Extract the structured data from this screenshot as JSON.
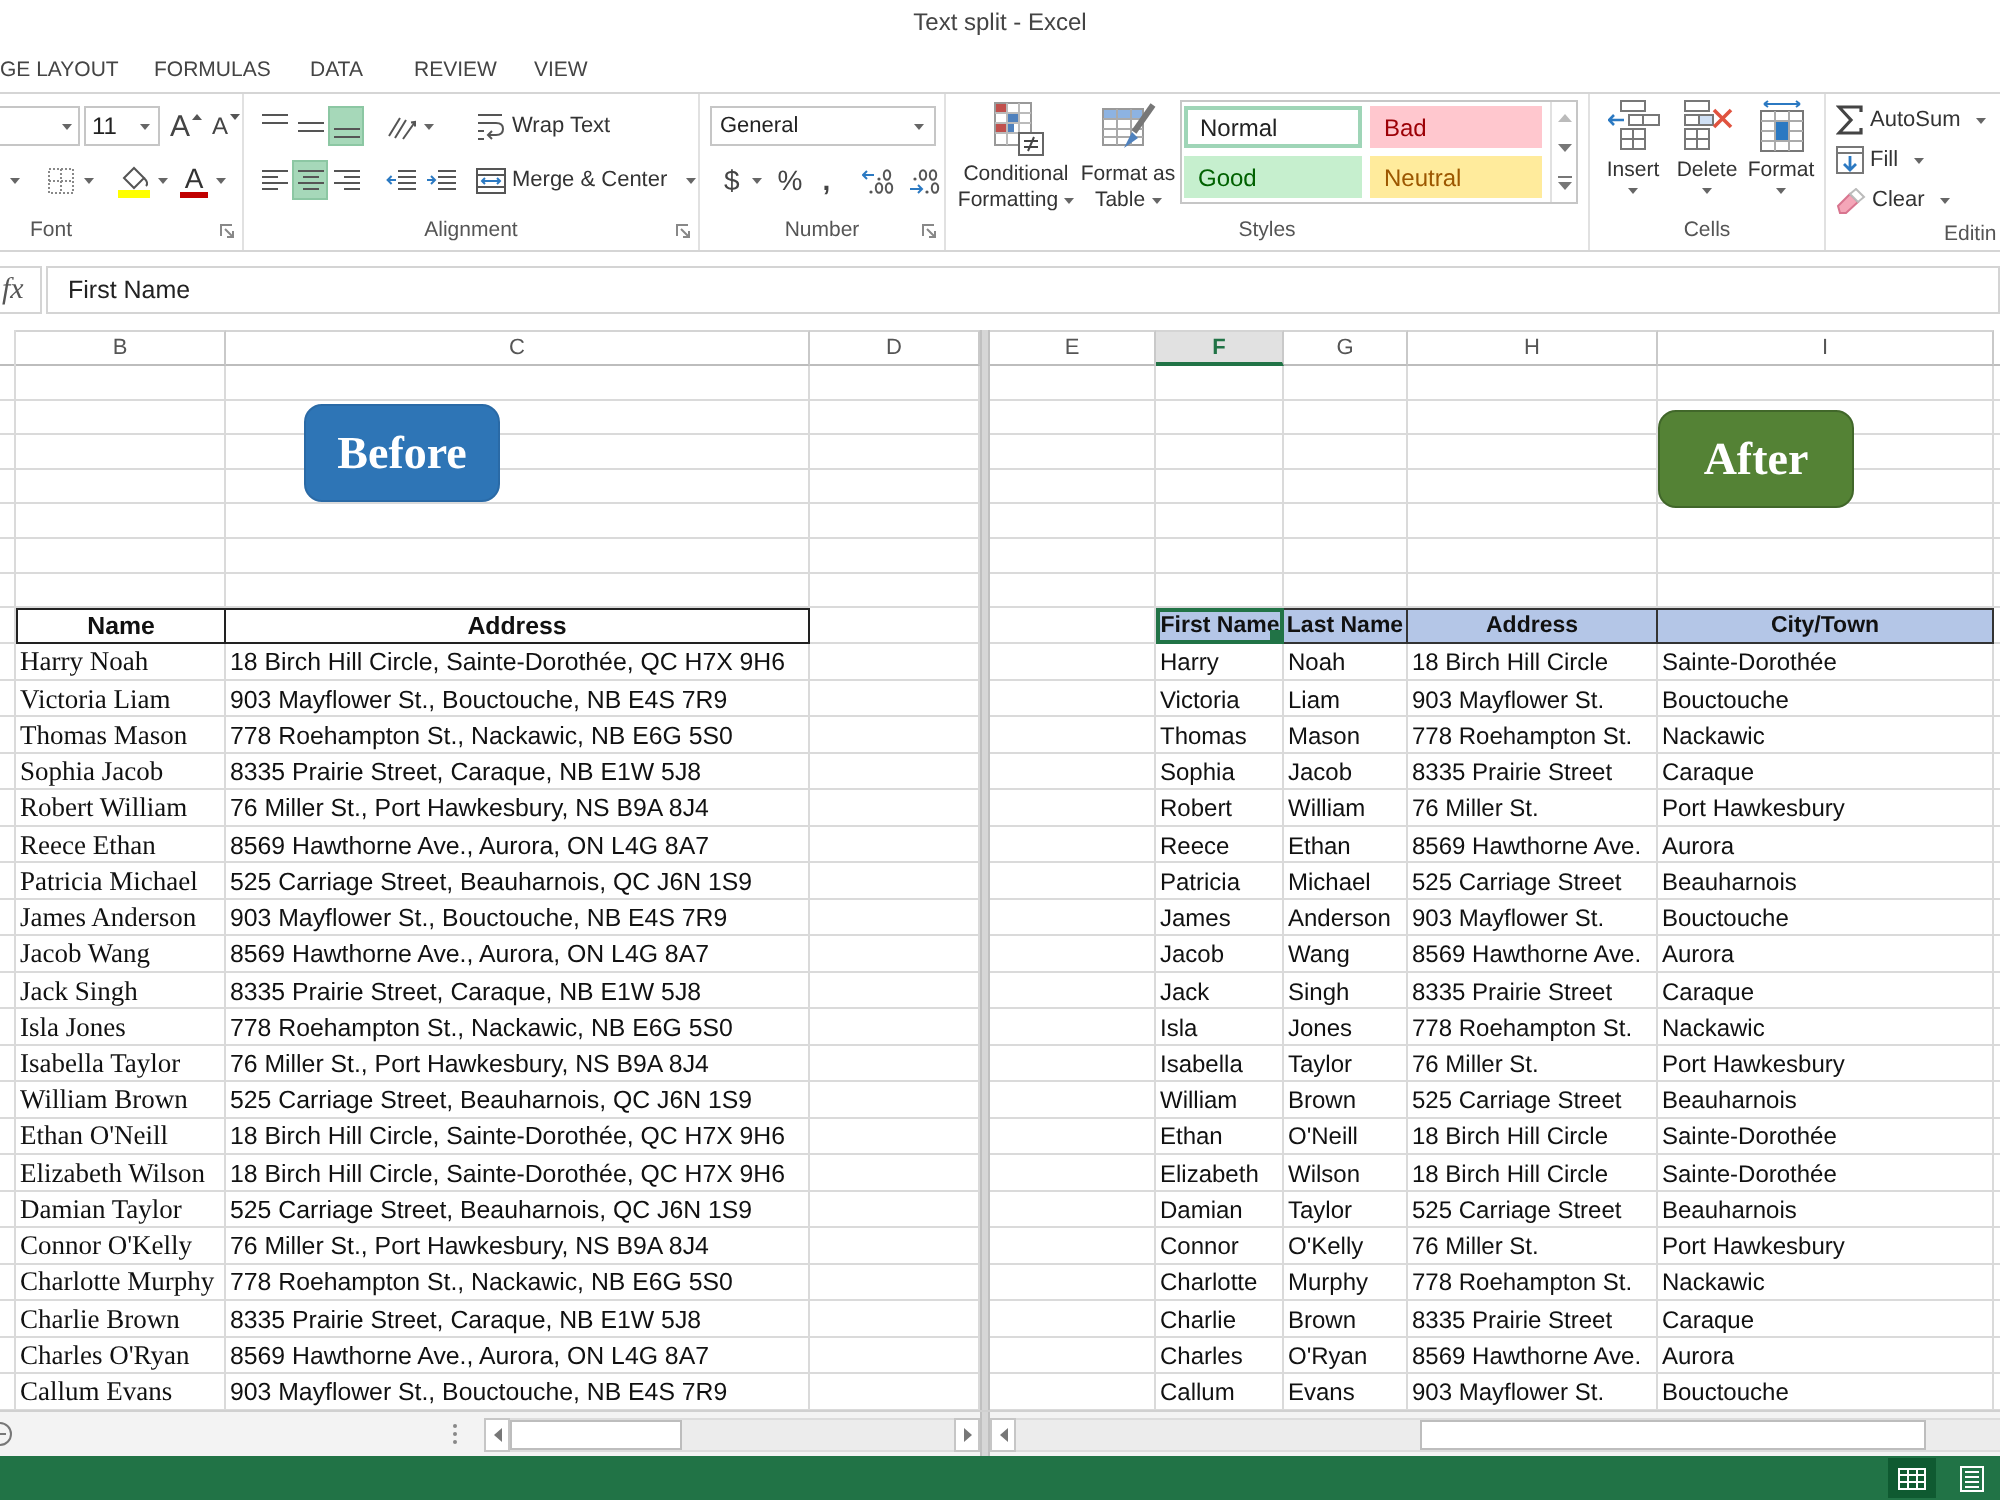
{
  "window": {
    "title": "Text split - Excel"
  },
  "ribbon_tabs": [
    "GE LAYOUT",
    "FORMULAS",
    "DATA",
    "REVIEW",
    "VIEW"
  ],
  "font_group": {
    "label": "Font",
    "font_size": "11",
    "grow_font": "A",
    "shrink_font": "A",
    "font_color": "A"
  },
  "alignment_group": {
    "label": "Alignment",
    "align_buttons": [
      {
        "kind": "top",
        "selected": false
      },
      {
        "kind": "middle",
        "selected": false
      },
      {
        "kind": "bottom",
        "selected": true
      },
      {
        "kind": "left",
        "selected": false
      },
      {
        "kind": "center",
        "selected": true
      },
      {
        "kind": "right",
        "selected": false
      }
    ],
    "wrap_text": "Wrap Text",
    "merge_center": "Merge & Center"
  },
  "number_group": {
    "label": "Number",
    "format": "General",
    "symbols": [
      {
        "text": "$",
        "dropdown": true
      },
      {
        "text": "%",
        "dropdown": false
      },
      {
        "text": ",",
        "dropdown": false
      }
    ],
    "decimal_buttons": [
      {
        "kind": "increase"
      },
      {
        "kind": "decrease"
      }
    ]
  },
  "styles_group": {
    "label": "Styles",
    "conditional_formatting": "Conditional Formatting",
    "format_as_table": "Format as Table",
    "cell_styles": [
      {
        "label": "Normal",
        "kind": "normal",
        "selected": true
      },
      {
        "label": "Bad",
        "kind": "bad",
        "selected": false
      },
      {
        "label": "Good",
        "kind": "good",
        "selected": false
      },
      {
        "label": "Neutral",
        "kind": "neutral",
        "selected": false
      }
    ]
  },
  "cells_group": {
    "label": "Cells",
    "buttons": [
      {
        "kind": "insert",
        "label": "Insert"
      },
      {
        "kind": "delete",
        "label": "Delete"
      },
      {
        "kind": "format",
        "label": "Format"
      }
    ]
  },
  "editing_group": {
    "label": "Editin",
    "buttons": [
      {
        "kind": "autosum",
        "label": "AutoSum"
      },
      {
        "kind": "fill",
        "label": "Fill"
      },
      {
        "kind": "clear",
        "label": "Clear"
      }
    ]
  },
  "formula_bar": {
    "function_label": "fx",
    "value": "First Name"
  },
  "left_pane": {
    "columns": [
      {
        "label": "B",
        "selected": false
      },
      {
        "label": "C",
        "selected": false
      },
      {
        "label": "D",
        "selected": false
      }
    ],
    "banner": "Before",
    "table": {
      "columns": [
        "Name",
        "Address"
      ],
      "rows": [
        [
          "Harry Noah",
          "18 Birch Hill Circle, Sainte-Dorothée, QC H7X 9H6"
        ],
        [
          "Victoria Liam",
          "903 Mayflower St., Bouctouche, NB E4S 7R9"
        ],
        [
          "Thomas Mason",
          "778 Roehampton St., Nackawic, NB E6G 5S0"
        ],
        [
          "Sophia Jacob",
          "8335 Prairie Street, Caraque, NB E1W 5J8"
        ],
        [
          "Robert William",
          "76 Miller St., Port Hawkesbury, NS B9A 8J4"
        ],
        [
          "Reece Ethan",
          "8569 Hawthorne Ave., Aurora, ON L4G 8A7"
        ],
        [
          "Patricia Michael",
          "525 Carriage Street, Beauharnois, QC J6N 1S9"
        ],
        [
          "James Anderson",
          "903 Mayflower St., Bouctouche, NB E4S 7R9"
        ],
        [
          "Jacob Wang",
          "8569 Hawthorne Ave., Aurora, ON L4G 8A7"
        ],
        [
          "Jack Singh",
          "8335 Prairie Street, Caraque, NB E1W 5J8"
        ],
        [
          "Isla Jones",
          "778 Roehampton St., Nackawic, NB E6G 5S0"
        ],
        [
          "Isabella Taylor",
          "76 Miller St., Port Hawkesbury, NS B9A 8J4"
        ],
        [
          "William Brown",
          "525 Carriage Street, Beauharnois, QC J6N 1S9"
        ],
        [
          "Ethan O'Neill",
          "18 Birch Hill Circle, Sainte-Dorothée, QC H7X 9H6"
        ],
        [
          "Elizabeth Wilson",
          "18 Birch Hill Circle, Sainte-Dorothée, QC H7X 9H6"
        ],
        [
          "Damian Taylor",
          "525 Carriage Street, Beauharnois, QC J6N 1S9"
        ],
        [
          "Connor O'Kelly",
          "76 Miller St., Port Hawkesbury, NS B9A 8J4"
        ],
        [
          "Charlotte Murphy",
          "778 Roehampton St., Nackawic, NB E6G 5S0"
        ],
        [
          "Charlie Brown",
          "8335 Prairie Street, Caraque, NB E1W 5J8"
        ],
        [
          "Charles O'Ryan",
          "8569 Hawthorne Ave., Aurora, ON L4G 8A7"
        ],
        [
          "Callum Evans",
          "903 Mayflower St., Bouctouche, NB E4S 7R9"
        ]
      ]
    }
  },
  "right_pane": {
    "columns": [
      {
        "label": "E",
        "selected": false
      },
      {
        "label": "F",
        "selected": true
      },
      {
        "label": "G",
        "selected": false
      },
      {
        "label": "H",
        "selected": false
      },
      {
        "label": "I",
        "selected": false
      }
    ],
    "banner": "After",
    "table": {
      "columns": [
        {
          "label": "First Name",
          "selected": true
        },
        {
          "label": "Last Name",
          "selected": false
        },
        {
          "label": "Address",
          "selected": false
        },
        {
          "label": "City/Town",
          "selected": false
        }
      ],
      "rows": [
        [
          "Harry",
          "Noah",
          "18 Birch Hill Circle",
          "Sainte-Dorothée"
        ],
        [
          "Victoria",
          "Liam",
          "903 Mayflower St.",
          "Bouctouche"
        ],
        [
          "Thomas",
          "Mason",
          "778 Roehampton St.",
          "Nackawic"
        ],
        [
          "Sophia",
          "Jacob",
          "8335 Prairie Street",
          "Caraque"
        ],
        [
          "Robert",
          "William",
          "76 Miller St.",
          "Port Hawkesbury"
        ],
        [
          "Reece",
          "Ethan",
          "8569 Hawthorne Ave.",
          "Aurora"
        ],
        [
          "Patricia",
          "Michael",
          "525 Carriage Street",
          "Beauharnois"
        ],
        [
          "James",
          "Anderson",
          "903 Mayflower St.",
          "Bouctouche"
        ],
        [
          "Jacob",
          "Wang",
          "8569 Hawthorne Ave.",
          "Aurora"
        ],
        [
          "Jack",
          "Singh",
          "8335 Prairie Street",
          "Caraque"
        ],
        [
          "Isla",
          "Jones",
          "778 Roehampton St.",
          "Nackawic"
        ],
        [
          "Isabella",
          "Taylor",
          "76 Miller St.",
          "Port Hawkesbury"
        ],
        [
          "William",
          "Brown",
          "525 Carriage Street",
          "Beauharnois"
        ],
        [
          "Ethan",
          "O'Neill",
          "18 Birch Hill Circle",
          "Sainte-Dorothée"
        ],
        [
          "Elizabeth",
          "Wilson",
          "18 Birch Hill Circle",
          "Sainte-Dorothée"
        ],
        [
          "Damian",
          "Taylor",
          "525 Carriage Street",
          "Beauharnois"
        ],
        [
          "Connor",
          "O'Kelly",
          "76 Miller St.",
          "Port Hawkesbury"
        ],
        [
          "Charlotte",
          "Murphy",
          "778 Roehampton St.",
          "Nackawic"
        ],
        [
          "Charlie",
          "Brown",
          "8335 Prairie Street",
          "Caraque"
        ],
        [
          "Charles",
          "O'Ryan",
          "8569 Hawthorne Ave.",
          "Aurora"
        ],
        [
          "Callum",
          "Evans",
          "903 Mayflower St.",
          "Bouctouche"
        ]
      ]
    }
  },
  "status_bar": {
    "views": [
      {
        "kind": "normal",
        "selected": true
      },
      {
        "kind": "page-layout",
        "selected": false
      }
    ]
  }
}
